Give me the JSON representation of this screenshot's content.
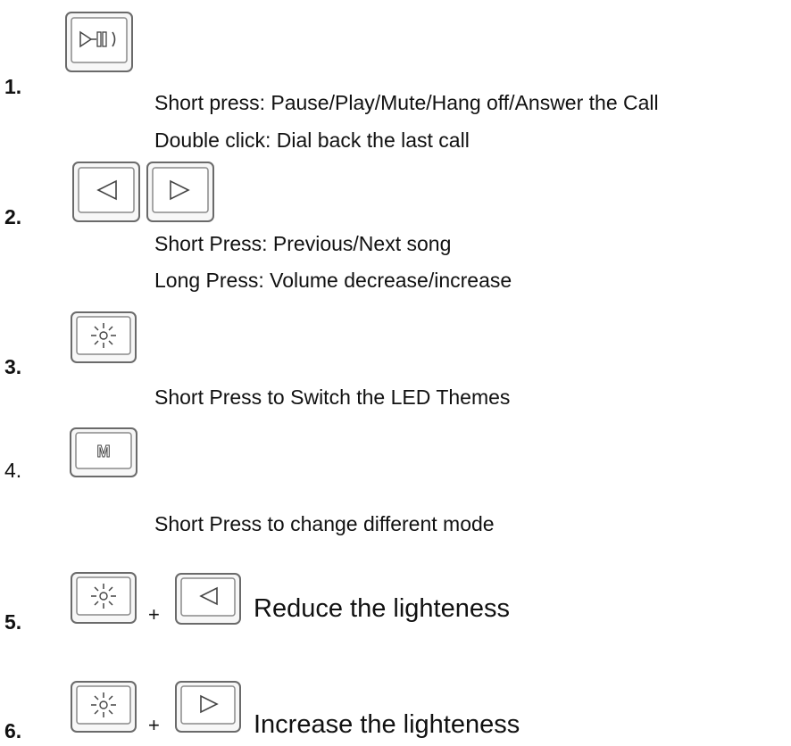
{
  "items": [
    {
      "number": "1.",
      "keys": [
        "play-pause-call-icon"
      ],
      "lines": [
        "Short press: Pause/Play/Mute/Hang off/Answer the Call",
        "Double click: Dial back the last call"
      ]
    },
    {
      "number": "2.",
      "keys": [
        "previous-icon",
        "next-icon"
      ],
      "lines": [
        "Short Press: Previous/Next song",
        "Long Press: Volume decrease/increase"
      ]
    },
    {
      "number": "3.",
      "keys": [
        "light-icon"
      ],
      "lines": [
        "Short Press to Switch the LED Themes"
      ]
    },
    {
      "number": "4.",
      "keys": [
        "mode-icon"
      ],
      "key_label": "M",
      "lines": [
        "Short Press to change different mode"
      ]
    },
    {
      "number": "5.",
      "keys": [
        "light-icon",
        "previous-icon"
      ],
      "plus": "+",
      "description": "Reduce the lighteness"
    },
    {
      "number": "6.",
      "keys": [
        "light-icon",
        "next-icon"
      ],
      "plus": "+",
      "description": "Increase the lighteness"
    }
  ]
}
